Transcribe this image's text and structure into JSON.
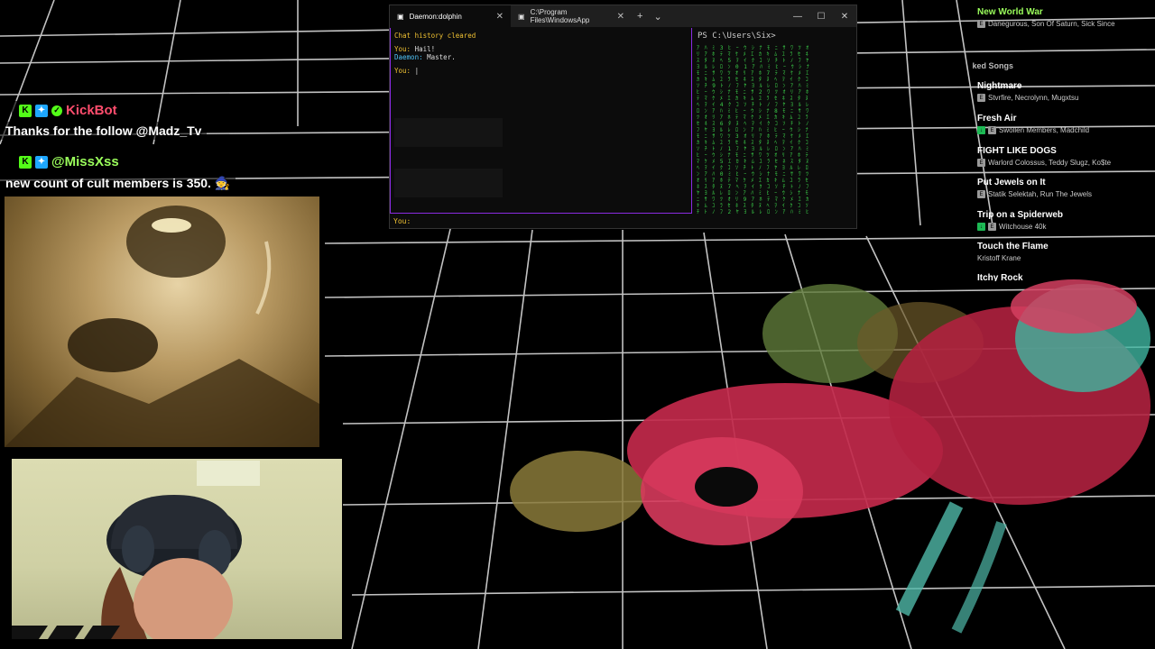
{
  "colors": {
    "kick_green": "#53fc18",
    "kickbot_name": "#ff4d6d",
    "user_name": "#9bff5c",
    "terminal_border": "#8a2be2",
    "terminal_you": "#f1c232",
    "terminal_daemon": "#4fc3f7",
    "matrix_green": "#3bd14a"
  },
  "chat": {
    "messages": [
      {
        "username": "KickBot",
        "text": "Thanks for the follow @Madz_Tv"
      },
      {
        "username": "@MissXss",
        "text": "new count of cult members is 350."
      }
    ],
    "emote": "🧙"
  },
  "terminal": {
    "tabs": [
      {
        "label": "Daemon:dolphin"
      },
      {
        "label": "C:\\Program Files\\WindowsApp"
      }
    ],
    "new_tab": "+",
    "dropdown": "⌄",
    "controls": {
      "minimize": "—",
      "maximize": "☐",
      "close": "✕"
    },
    "left_pane": {
      "status": "Chat history cleared",
      "lines": [
        {
          "speaker": "You:",
          "text": "Hail!"
        },
        {
          "speaker": "Daemon:",
          "text": "Master."
        },
        {
          "speaker": "You:",
          "text": "|"
        }
      ],
      "bottom_prompt": "You:"
    },
    "right_pane": {
      "prompt": "PS C:\\Users\\Six>"
    }
  },
  "playlist": {
    "section_label": "iked Songs",
    "songs": [
      {
        "title": "New World War",
        "artists": "Danegurous, Son Of Saturn, Sick Since",
        "tags": [
          "E"
        ]
      },
      {
        "title": "Nightmare",
        "artists": "Stvrfire, Necrolynn, Mugxtsu",
        "tags": [
          "E"
        ]
      },
      {
        "title": "Fresh Air",
        "artists": "Swollen Members, Madchild",
        "tags": [
          "download",
          "E"
        ]
      },
      {
        "title": "FIGHT LIKE DOGS",
        "artists": "Warlord Colossus, Teddy Slugz, Ko$te",
        "tags": [
          "E"
        ]
      },
      {
        "title": "Put Jewels on It",
        "artists": "Statik Selektah, Run The Jewels",
        "tags": [
          "E"
        ]
      },
      {
        "title": "Trip on a Spiderweb",
        "artists": "Witchouse 40k",
        "tags": [
          "download",
          "E"
        ]
      },
      {
        "title": "Touch the Flame",
        "artists": "Kristoff Krane",
        "tags": []
      },
      {
        "title": "Itchy Rock",
        "artists": "",
        "tags": []
      }
    ]
  }
}
